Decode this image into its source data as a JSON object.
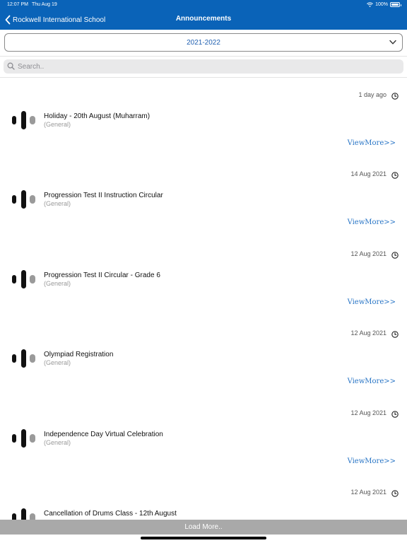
{
  "status_bar": {
    "time": "12:07 PM",
    "date": "Thu Aug 19",
    "battery": "100%",
    "battery_level": 1.0
  },
  "header": {
    "back_label": "Rockwell International School",
    "title": "Announcements"
  },
  "year_selector": {
    "value": "2021-2022",
    "icon": "chevron-down-icon"
  },
  "search": {
    "placeholder": "Search..",
    "value": "",
    "icon": "search-icon"
  },
  "announcements": [
    {
      "time": "1 day ago",
      "title": "Holiday - 20th August (Muharram)",
      "category": "(General)",
      "view_more": "ViewMore>>"
    },
    {
      "time": "14 Aug 2021",
      "title": "Progression Test II Instruction Circular",
      "category": "(General)",
      "view_more": "ViewMore>>"
    },
    {
      "time": "12 Aug 2021",
      "title": "Progression Test II Circular - Grade 6",
      "category": "(General)",
      "view_more": "ViewMore>>"
    },
    {
      "time": "12 Aug 2021",
      "title": "Olympiad Registration",
      "category": "(General)",
      "view_more": "ViewMore>>"
    },
    {
      "time": "12 Aug 2021",
      "title": "Independence Day Virtual Celebration",
      "category": "(General)",
      "view_more": "ViewMore>>"
    },
    {
      "time": "12 Aug 2021",
      "title": "Cancellation of Drums Class - 12th August",
      "category": "",
      "view_more": ""
    }
  ],
  "load_more_label": "Load More..",
  "colors": {
    "header_bg": "#0a63b8",
    "accent": "#1f5fb0",
    "link": "#2a76c6",
    "load_more_bg": "#a9a9a9"
  }
}
